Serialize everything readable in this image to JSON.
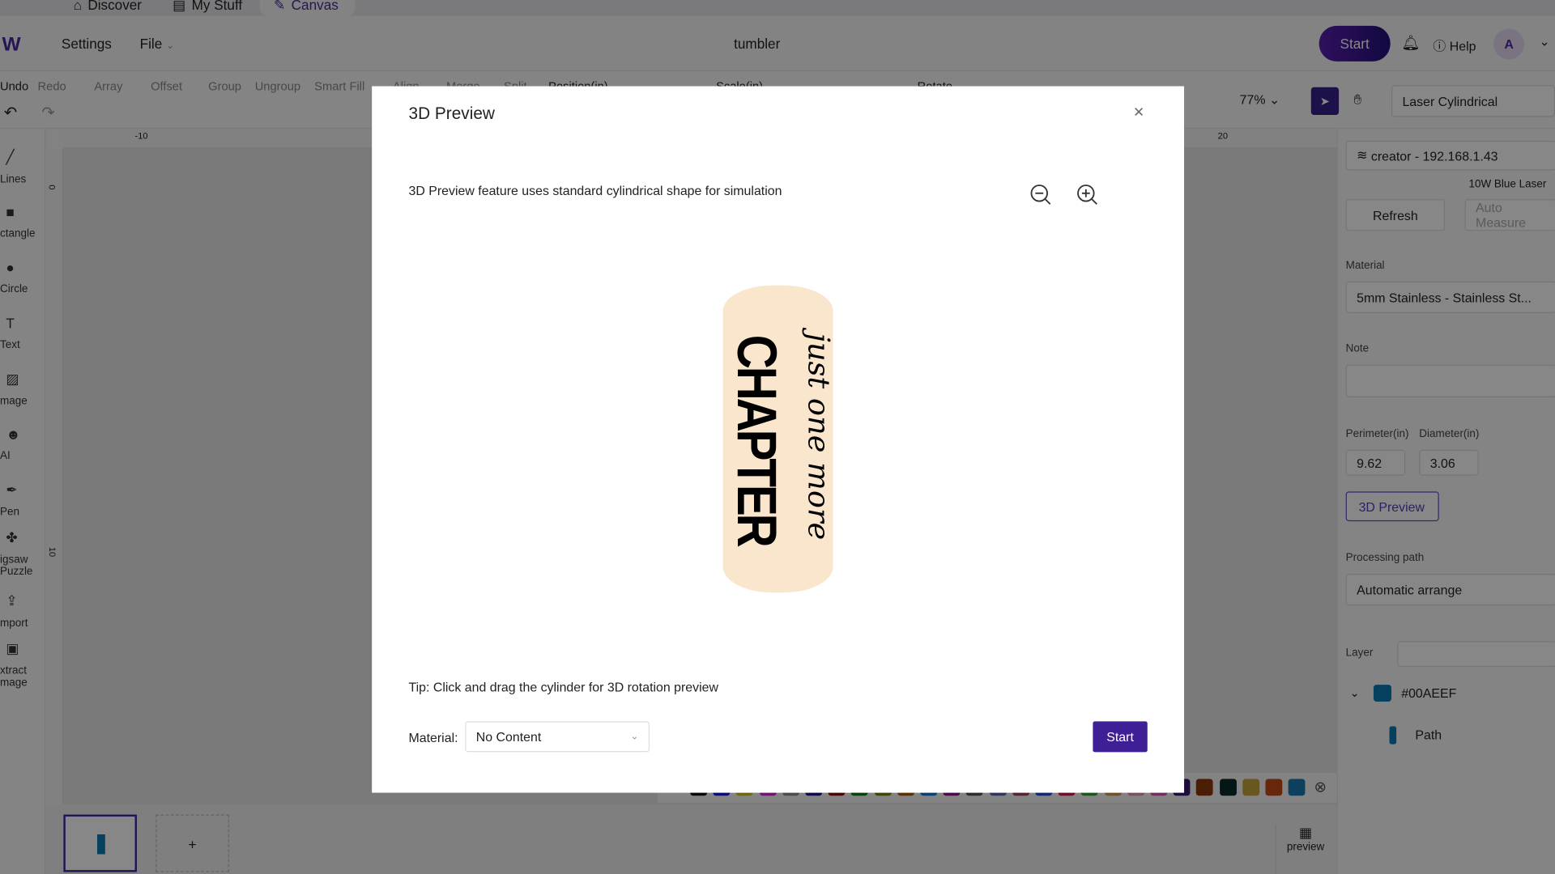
{
  "tabs": [
    {
      "label": "Discover",
      "icon": "home-icon"
    },
    {
      "label": "My Stuff",
      "icon": "folder-icon"
    },
    {
      "label": "Canvas",
      "icon": "pen-icon",
      "active": true
    }
  ],
  "topbar": {
    "settings": "Settings",
    "file": "File",
    "title": "tumbler",
    "start": "Start",
    "help": "Help",
    "avatar": "A"
  },
  "toolbar": {
    "items": [
      "Undo",
      "Redo",
      "Array",
      "Offset",
      "Group",
      "Ungroup",
      "Smart Fill",
      "Align",
      "Merge",
      "Split",
      "Position(in)",
      "Scale(in)",
      "Rotate"
    ],
    "zoom": "77%",
    "mode": "Laser Cylindrical"
  },
  "leftbar": [
    "Lines",
    "ctangle",
    "Circle",
    "Text",
    "mage",
    "AI",
    "Pen",
    "igsaw\nPuzzle",
    "mport",
    "xtract\nmage"
  ],
  "rulers": {
    "top": [
      "-10",
      "20"
    ],
    "left": [
      "0",
      "10"
    ]
  },
  "right": {
    "device": "creator - 192.168.1.43",
    "laser": "10W Blue Laser",
    "refresh": "Refresh",
    "auto_measure": "Auto Measure",
    "material_label": "Material",
    "material": "5mm Stainless - Stainless St...",
    "note_label": "Note",
    "perimeter_label": "Perimeter(in)",
    "diameter_label": "Diameter(in)",
    "perimeter": "9.62",
    "diameter": "3.06",
    "preview_btn": "3D Preview",
    "path_label": "Processing path",
    "path": "Automatic arrange",
    "layer_label": "Layer",
    "layer_color": "#00AEEF",
    "layer_name": "#00AEEF",
    "path_item": "Path"
  },
  "palette": [
    "#111111",
    "#1a1adf",
    "#c9c92a",
    "#d42ad4",
    "#909090",
    "#1a1a8a",
    "#8a1010",
    "#127d12",
    "#808010",
    "#a86010",
    "#1a7ad4",
    "#8a1a8a",
    "#555555",
    "#5a6aaa",
    "#9a4a5a",
    "#2a4ad4",
    "#d41a4a",
    "#3aa03a",
    "#d49a5a",
    "#e49ab4",
    "#d45ab4",
    "#3a1a6a",
    "#8a3a0a",
    "#0a2a2a",
    "#c4a43a",
    "#c44a1a",
    "#1a7ab4"
  ],
  "bottom": {
    "add": "+",
    "preview": "preview"
  },
  "modal": {
    "title": "3D Preview",
    "info": "3D Preview feature uses standard cylindrical shape for simulation",
    "design_main": "CHAPTER",
    "design_script": "just one more",
    "tip": "Tip: Click and drag the cylinder for 3D rotation preview",
    "material_label": "Material:",
    "material_value": "No Content",
    "start": "Start",
    "cylinder_color": "#fae6cc"
  },
  "brand_color": "#4b2a9e"
}
